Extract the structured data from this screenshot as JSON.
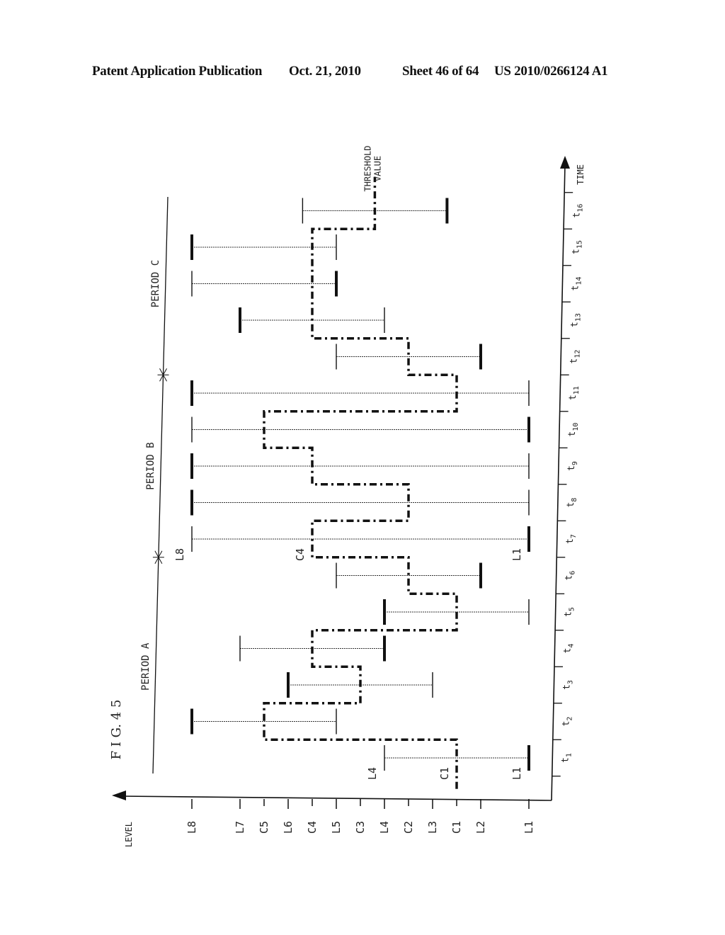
{
  "header": {
    "left": "Patent Application Publication",
    "date": "Oct. 21, 2010",
    "sheet": "Sheet 46 of 64",
    "number": "US 2010/0266124 A1"
  },
  "figure": {
    "title": "F I G. 4 5",
    "level_axis_label": "LEVEL",
    "time_axis_label": "TIME",
    "threshold_label_line1": "THRESHOLD",
    "threshold_label_line2": "VALUE",
    "periods": [
      {
        "label": "PERIOD A",
        "from_slot": 1,
        "to_slot": 6
      },
      {
        "label": "PERIOD B",
        "from_slot": 7,
        "to_slot": 11
      },
      {
        "label": "PERIOD C",
        "from_slot": 12,
        "to_slot": 16
      }
    ],
    "annotations": [
      {
        "text": "L4",
        "slot": 1,
        "level": 3.0,
        "side": "left"
      },
      {
        "text": "C1",
        "slot": 1,
        "level": 1.5,
        "side": "left"
      },
      {
        "text": "L1",
        "slot": 1,
        "level": 0.0,
        "side": "left"
      },
      {
        "text": "L8",
        "slot": 7,
        "level": 7.0,
        "side": "left"
      },
      {
        "text": "C4",
        "slot": 7,
        "level": 4.5,
        "side": "left"
      },
      {
        "text": "L1",
        "slot": 7,
        "level": 0.0,
        "side": "left"
      }
    ]
  },
  "chart_data": {
    "type": "step-range",
    "title": "F I G. 4 5",
    "xlabel": "LEVEL",
    "ylabel": "TIME",
    "orientation": "rotated 90deg counter-clockwise (level axis horizontal, increasing to the left; time axis vertical, increasing upward)",
    "level_ticks": [
      {
        "label": "L1",
        "value": 0.0
      },
      {
        "label": "L2",
        "value": 1.0
      },
      {
        "label": "C1",
        "value": 1.5
      },
      {
        "label": "L3",
        "value": 2.0
      },
      {
        "label": "C2",
        "value": 2.5
      },
      {
        "label": "L4",
        "value": 3.0
      },
      {
        "label": "C3",
        "value": 3.5
      },
      {
        "label": "L5",
        "value": 4.0
      },
      {
        "label": "C4",
        "value": 4.5
      },
      {
        "label": "L6",
        "value": 5.0
      },
      {
        "label": "C5",
        "value": 5.5
      },
      {
        "label": "L7",
        "value": 6.0
      },
      {
        "label": "L8",
        "value": 7.0
      }
    ],
    "time_ticks": [
      "t1",
      "t2",
      "t3",
      "t4",
      "t5",
      "t6",
      "t7",
      "t8",
      "t9",
      "t10",
      "t11",
      "t12",
      "t13",
      "t14",
      "t15",
      "t16"
    ],
    "series": [
      {
        "name": "level range",
        "ranges": [
          {
            "t": "t1",
            "high": 3.0,
            "low": 0.0,
            "thick_end": "low"
          },
          {
            "t": "t2",
            "high": 7.0,
            "low": 4.0,
            "thick_end": "high"
          },
          {
            "t": "t3",
            "high": 5.0,
            "low": 2.0,
            "thick_end": "high"
          },
          {
            "t": "t4",
            "high": 6.0,
            "low": 3.0,
            "thick_end": "low"
          },
          {
            "t": "t5",
            "high": 3.0,
            "low": 0.0,
            "thick_end": "high"
          },
          {
            "t": "t6",
            "high": 4.0,
            "low": 1.0,
            "thick_end": "low"
          },
          {
            "t": "t7",
            "high": 7.0,
            "low": 0.0,
            "thick_end": "low"
          },
          {
            "t": "t8",
            "high": 7.0,
            "low": 0.0,
            "thick_end": "high"
          },
          {
            "t": "t9",
            "high": 7.0,
            "low": 0.0,
            "thick_end": "high"
          },
          {
            "t": "t10",
            "high": 7.0,
            "low": 0.0,
            "thick_end": "low"
          },
          {
            "t": "t11",
            "high": 7.0,
            "low": 0.0,
            "thick_end": "high"
          },
          {
            "t": "t12",
            "high": 4.0,
            "low": 1.0,
            "thick_end": "low"
          },
          {
            "t": "t13",
            "high": 6.0,
            "low": 3.0,
            "thick_end": "high"
          },
          {
            "t": "t14",
            "high": 7.0,
            "low": 4.0,
            "thick_end": "low"
          },
          {
            "t": "t15",
            "high": 7.0,
            "low": 4.0,
            "thick_end": "high"
          },
          {
            "t": "t16",
            "high": 4.7,
            "low": 1.7,
            "thick_end": "low"
          }
        ]
      },
      {
        "name": "threshold value (dash-dot step)",
        "values": [
          1.5,
          5.5,
          3.5,
          4.5,
          1.5,
          2.5,
          4.5,
          2.5,
          4.5,
          5.5,
          1.5,
          2.5,
          4.5,
          4.5,
          4.5,
          3.2
        ]
      }
    ]
  }
}
